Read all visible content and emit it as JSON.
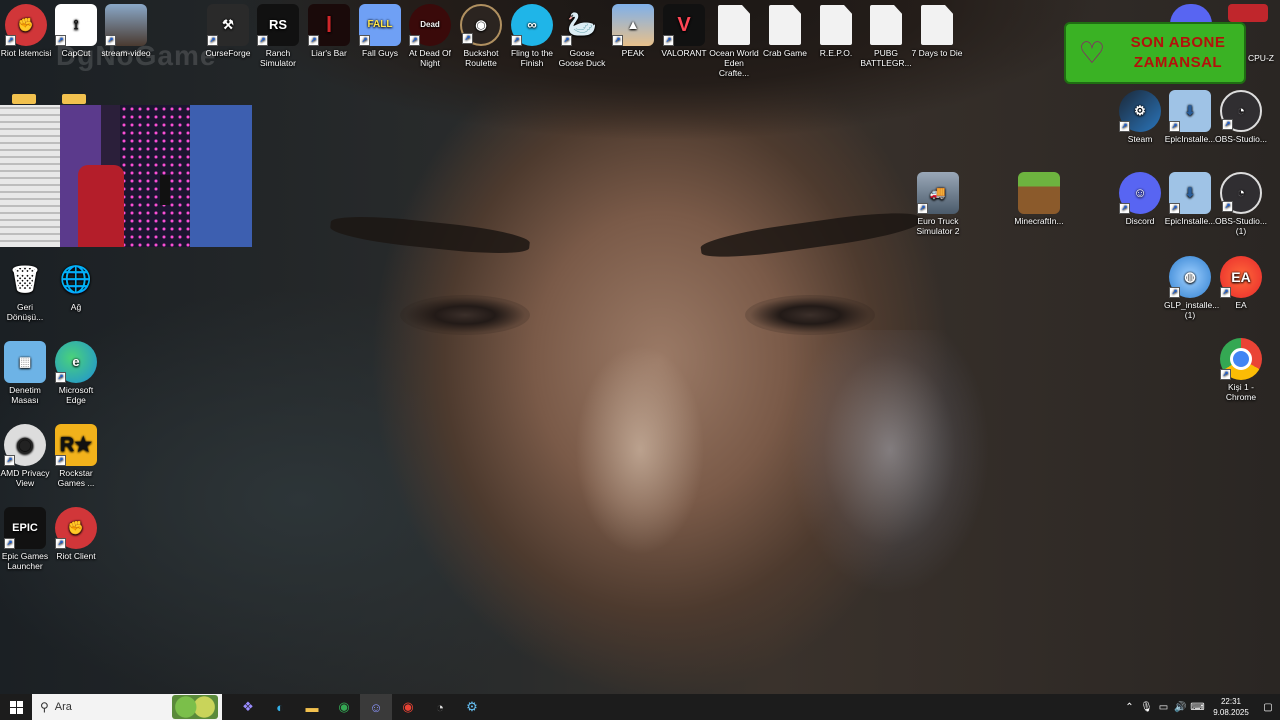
{
  "desktop": {
    "top_row": [
      {
        "label": "Riot İstemcisi",
        "icon": "riot-icon",
        "color": "#d13639"
      },
      {
        "label": "CapCut",
        "icon": "capcut-icon",
        "color": "#1b1b1b"
      },
      {
        "label": "stream-video",
        "icon": "stream-photo-icon",
        "color": "#6a8fb0"
      },
      {
        "label": "CurseForge",
        "icon": "curseforge-anvil-icon",
        "color": "#2a2a2a"
      },
      {
        "label": "Ranch Simulator",
        "icon": "ranch-simulator-icon",
        "color": "#222"
      },
      {
        "label": "Liar's Bar",
        "icon": "liars-bar-icon",
        "color": "#7a0f12"
      },
      {
        "label": "Fall Guys",
        "icon": "fall-guys-icon",
        "color": "#5d8ff0"
      },
      {
        "label": "At Dead Of Night",
        "icon": "at-dead-of-night-icon",
        "color": "#5a1111"
      },
      {
        "label": "Buckshot Roulette",
        "icon": "buckshot-roulette-icon",
        "color": "#3a2c22"
      },
      {
        "label": "Fling to the Finish",
        "icon": "fling-to-finish-icon",
        "color": "#22b0e0"
      },
      {
        "label": "Goose Goose Duck",
        "icon": "goose-goose-duck-icon",
        "color": "#e8e8e8"
      },
      {
        "label": "PEAK",
        "icon": "peak-icon",
        "color": "#5c8fd6"
      },
      {
        "label": "VALORANT",
        "icon": "valorant-icon",
        "color": "#ff4655"
      },
      {
        "label": "Ocean World Eden Crafte...",
        "icon": "file-icon",
        "color": "#f2f2f2"
      },
      {
        "label": "Crab Game",
        "icon": "file-icon",
        "color": "#f2f2f2"
      },
      {
        "label": "R.E.P.O.",
        "icon": "file-icon",
        "color": "#f2f2f2"
      },
      {
        "label": "PUBG BATTLEGR...",
        "icon": "file-icon",
        "color": "#f2f2f2"
      },
      {
        "label": "7 Days to Die",
        "icon": "file-icon",
        "color": "#f2f2f2"
      }
    ],
    "left_column": [
      {
        "label": "Geri Dönüşü...",
        "icon": "recycle-bin-icon",
        "color": "#bcd"
      },
      {
        "label": "Ağ",
        "icon": "network-icon",
        "color": "#3c8fd8"
      },
      {
        "label": "Denetim Masası",
        "icon": "control-panel-icon",
        "color": "#5aa8e0"
      },
      {
        "label": "Microsoft Edge",
        "icon": "edge-icon",
        "color": "#1e8fd8"
      },
      {
        "label": "AMD Privacy View",
        "icon": "amd-privacy-view-icon",
        "color": "#3a3a3a"
      },
      {
        "label": "Rockstar Games ...",
        "icon": "rockstar-icon",
        "color": "#f2b21b"
      },
      {
        "label": "Epic Games Launcher",
        "icon": "epic-games-icon",
        "color": "#111"
      },
      {
        "label": "Riot Client",
        "icon": "riot-client-icon",
        "color": "#d13639"
      }
    ],
    "right_column": [
      {
        "label": "Steam",
        "icon": "steam-icon",
        "color": "#1b2838"
      },
      {
        "label": "EpicInstalle...",
        "icon": "installer-icon",
        "color": "#3b6aa8"
      },
      {
        "label": "OBS-Studio...",
        "icon": "obs-icon",
        "color": "#302e31"
      },
      {
        "label": "Discord",
        "icon": "discord-icon",
        "color": "#5865f2"
      },
      {
        "label": "EpicInstalle...",
        "icon": "installer-icon",
        "color": "#3b6aa8"
      },
      {
        "label": "OBS-Studio... (1)",
        "icon": "obs-icon",
        "color": "#302e31"
      },
      {
        "label": "GLP_installe... (1)",
        "icon": "glp-installer-icon",
        "color": "#2f7fd0"
      },
      {
        "label": "EA",
        "icon": "ea-icon",
        "color": "#ff3b2f"
      },
      {
        "label": "Kişi 1 - Chrome",
        "icon": "chrome-icon",
        "color": "#4285f4"
      }
    ],
    "middle_icons": [
      {
        "label": "Euro Truck Simulator 2",
        "icon": "euro-truck-icon",
        "color": "#6a7a8a"
      },
      {
        "label": "MinecraftIn...",
        "icon": "minecraft-icon",
        "color": "#5f9f35"
      }
    ],
    "partial_icons": [
      {
        "label": "CPU-Z",
        "icon": "cpu-z-icon"
      },
      {
        "label": "Discord",
        "icon": "discord-icon"
      }
    ],
    "watermark": "DgNoGame"
  },
  "overlay": {
    "subscriber_box": {
      "line1": "SON ABONE",
      "line2": "ZAMANSAL",
      "heart_icon": "heart-icon",
      "bg": "#3ab224",
      "text_color": "#b3110b"
    },
    "webcam": "webcam-overlay"
  },
  "taskbar": {
    "search_placeholder": "Ara",
    "apps": [
      {
        "name": "copilot-icon",
        "color": "#7a6cf0"
      },
      {
        "name": "edge-icon",
        "color": "#1e8fd8"
      },
      {
        "name": "file-explorer-icon",
        "color": "#f2c14e"
      },
      {
        "name": "chrome-icon",
        "color": "#34a853"
      },
      {
        "name": "discord-icon",
        "color": "#5865f2"
      },
      {
        "name": "chrome-profile-icon",
        "color": "#ea4335"
      },
      {
        "name": "obs-icon",
        "color": "#302e31"
      },
      {
        "name": "steam-icon",
        "color": "#1b2838"
      }
    ],
    "time": "22:31",
    "date": "9.08.2025"
  }
}
